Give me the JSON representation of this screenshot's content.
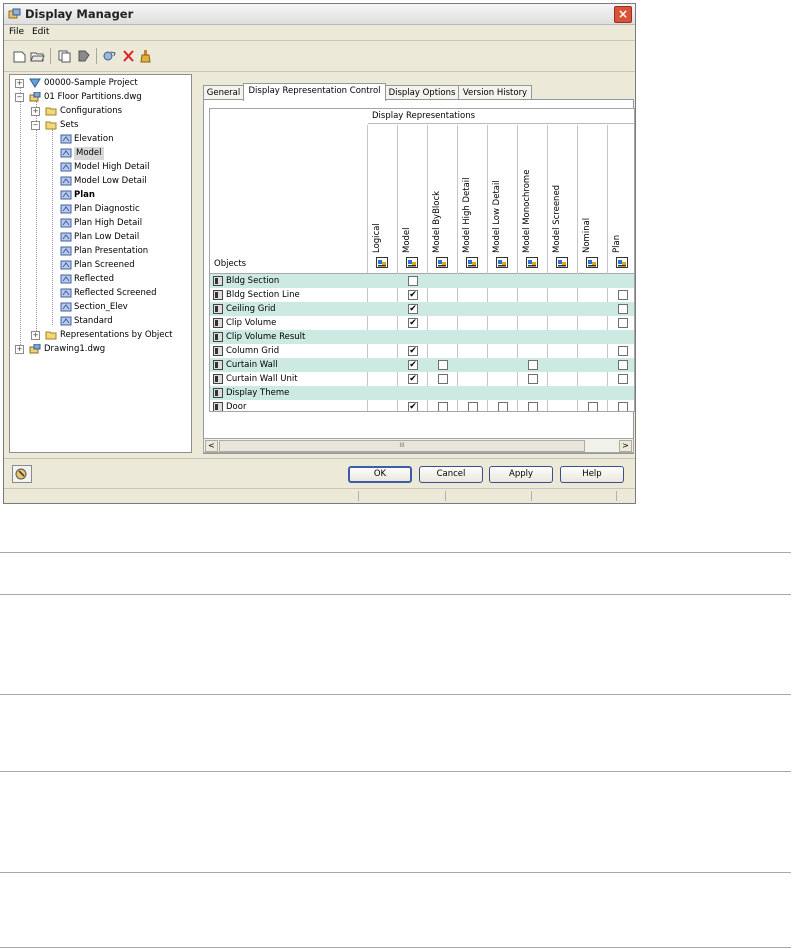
{
  "window": {
    "title": "Display Manager",
    "close_label": "×"
  },
  "menu": {
    "file": "File",
    "edit": "Edit"
  },
  "toolbar": {
    "icons": [
      "new-icon",
      "open-icon",
      "copy-icon",
      "purge-icon",
      "edit-icon",
      "delete-icon",
      "brush-icon"
    ]
  },
  "tree": {
    "project": "00000-Sample Project",
    "drawing1": "01 Floor Partitions.dwg",
    "configurations": "Configurations",
    "sets": "Sets",
    "set_items": [
      "Elevation",
      "Model",
      "Model High Detail",
      "Model Low Detail",
      "Plan",
      "Plan Diagnostic",
      "Plan High Detail",
      "Plan Low Detail",
      "Plan Presentation",
      "Plan Screened",
      "Reflected",
      "Reflected Screened",
      "Section_Elev",
      "Standard"
    ],
    "selected": "Model",
    "bold_item": "Plan",
    "reps_by_object": "Representations by Object",
    "drawing2": "Drawing1.dwg"
  },
  "tabs": [
    "General",
    "Display Representation Control",
    "Display Options",
    "Version History"
  ],
  "active_tab": "Display Representation Control",
  "grid": {
    "group_header": "Display Representations",
    "objects_header": "Objects",
    "columns": [
      "Logical",
      "Model",
      "Model ByBlock",
      "Model High Detail",
      "Model Low Detail",
      "Model Monochrome",
      "Model Screened",
      "Nominal",
      "Plan"
    ],
    "rows": [
      {
        "name": "Bldg Section",
        "checks": [
          null,
          false,
          null,
          null,
          null,
          null,
          null,
          null,
          null
        ]
      },
      {
        "name": "Bldg Section Line",
        "checks": [
          null,
          true,
          null,
          null,
          null,
          null,
          null,
          null,
          false
        ]
      },
      {
        "name": "Ceiling Grid",
        "checks": [
          null,
          true,
          null,
          null,
          null,
          null,
          null,
          null,
          false
        ]
      },
      {
        "name": "Clip Volume",
        "checks": [
          null,
          true,
          null,
          null,
          null,
          null,
          null,
          null,
          false
        ]
      },
      {
        "name": "Clip Volume Result",
        "checks": [
          null,
          null,
          null,
          null,
          null,
          null,
          null,
          null,
          null
        ]
      },
      {
        "name": "Column Grid",
        "checks": [
          null,
          true,
          null,
          null,
          null,
          null,
          null,
          null,
          false
        ]
      },
      {
        "name": "Curtain Wall",
        "checks": [
          null,
          true,
          false,
          null,
          null,
          false,
          null,
          null,
          false
        ]
      },
      {
        "name": "Curtain Wall Unit",
        "checks": [
          null,
          true,
          false,
          null,
          null,
          false,
          null,
          null,
          false
        ]
      },
      {
        "name": "Display Theme",
        "checks": [
          null,
          null,
          null,
          null,
          null,
          null,
          null,
          null,
          null
        ]
      },
      {
        "name": "Door",
        "checks": [
          null,
          true,
          false,
          false,
          false,
          false,
          null,
          false,
          false
        ]
      }
    ]
  },
  "buttons": {
    "ok": "OK",
    "cancel": "Cancel",
    "apply": "Apply",
    "help": "Help"
  },
  "scroll": {
    "left": "<",
    "right": ">",
    "grip": "III"
  },
  "checkmark": "✔"
}
